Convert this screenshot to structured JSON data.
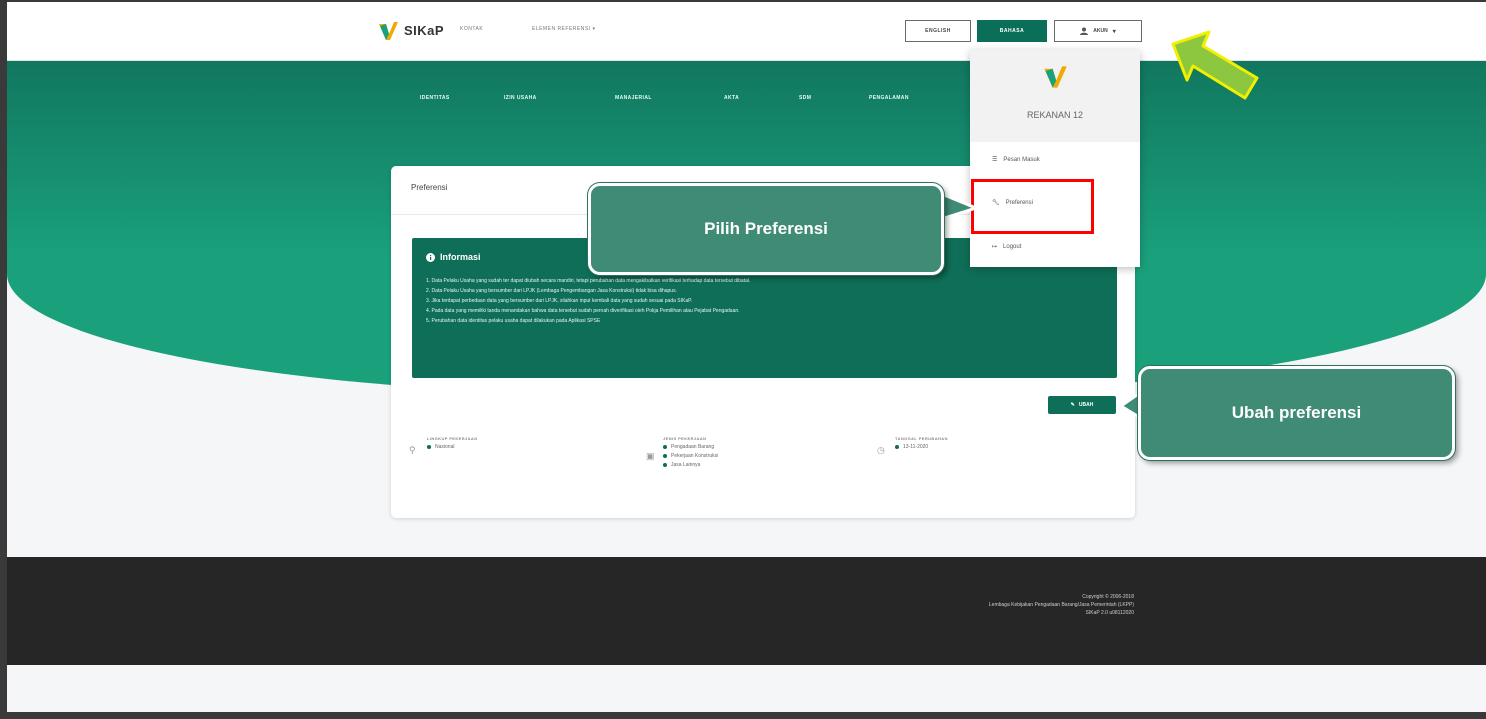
{
  "navbar": {
    "brand": "SIKaP",
    "links": [
      "KONTAK",
      "ELEMEN REFERENSI ▾"
    ],
    "lang_en": "ENGLISH",
    "lang_id": "BAHASA",
    "account_label": "AKUN"
  },
  "tabs": [
    "IDENTITAS",
    "IZIN USAHA",
    "MANAJERIAL",
    "AKTA",
    "SDM",
    "PENGALAMAN"
  ],
  "dropdown": {
    "user": "REKANAN 12",
    "items": [
      "Pesan Masuk",
      "Preferensi",
      "Logout"
    ]
  },
  "card": {
    "title": "Preferensi",
    "info_title": "Informasi",
    "info_items": [
      "1. Data Pelaku Usaha yang sudah ter dapat diubah secara mandiri, tetapi perubahan data mengakibatkan verifikasi terhadap data tersebut dibatal.",
      "2. Data Pelaku Usaha yang bersumber dari LPJK (Lembaga Pengembangan Jasa Konstruksi) tidak bisa dihapus.",
      "3. Jika terdapat perbedaan data yang bersumber dari LPJK, silahkan input kembali data yang sudah sesuai pada SIKaP.",
      "4. Pada data yang memiliki tanda menandakan bahwa data tersebut sudah pernah diverifikasi oleh Pokja Pemilihan atau Pejabat Pengadaan.",
      "5. Perubahan data identitas pelaku usaha dapat dilakukan pada Aplikasi SPSE"
    ],
    "ubah_label": "UBAH",
    "meta": {
      "lingkup_label": "LINGKUP PEKERJAAN",
      "lingkup_values": [
        "Nasional"
      ],
      "jenis_label": "JENIS PEKERJAAN",
      "jenis_values": [
        "Pengadaan Barang",
        "Pekerjaan Konstruksi",
        "Jasa Lainnya"
      ],
      "tanggal_label": "TANGGAL PERUBAHAN",
      "tanggal_values": [
        "13-11-2020"
      ]
    }
  },
  "footer": {
    "lines": [
      "Copyright © 2006-2018",
      "Lembaga Kebijakan Pengadaan Barang/Jasa Pemerintah (LKPP)",
      "SIKaP 2.0 u08112020"
    ]
  },
  "callouts": {
    "pilih": "Pilih Preferensi",
    "ubah": "Ubah preferensi"
  },
  "colors": {
    "primary_green": "#1aa17c",
    "dark_green": "#0f6e57",
    "highlight_red": "#ff0000",
    "arrow_green": "#8dc63f"
  }
}
